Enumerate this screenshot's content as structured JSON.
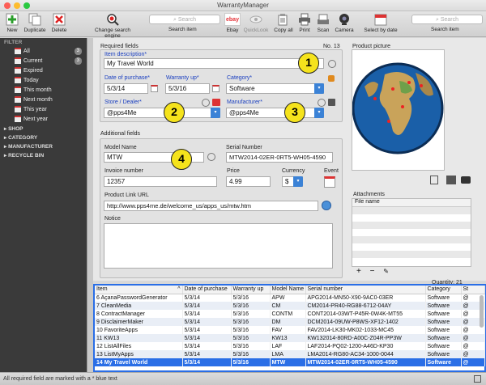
{
  "window": {
    "title": "WarrantyManager"
  },
  "toolbar": {
    "new": "New",
    "duplicate": "Duplicate",
    "delete": "Delete",
    "change_search_engine": "Change search engine",
    "search_item": "Search item",
    "search_placeholder": "Search",
    "ebay": "Ebay",
    "quicklook": "QuickLook",
    "copy_all": "Copy all",
    "print": "Print",
    "scan": "Scan",
    "camera": "Camera",
    "select_by_date": "Select by date",
    "search_item2": "Search item",
    "search_placeholder2": "Search",
    "ebay_logo": "ebay"
  },
  "sidebar": {
    "filter_heading": "FILTER",
    "items": [
      {
        "label": "All",
        "badge": "3"
      },
      {
        "label": "Current",
        "badge": "3"
      },
      {
        "label": "Expired",
        "badge": ""
      },
      {
        "label": "Today",
        "badge": ""
      },
      {
        "label": "This month",
        "badge": ""
      },
      {
        "label": "Next month",
        "badge": ""
      },
      {
        "label": "This year",
        "badge": ""
      },
      {
        "label": "Next year",
        "badge": ""
      }
    ],
    "sections": [
      "SHOP",
      "CATEGORY",
      "MANUFACTURER",
      "RECYCLE BIN"
    ]
  },
  "form": {
    "required_heading": "Required fields",
    "record_no": "No. 13",
    "item_description_label": "Item description*",
    "item_description": "My Travel World",
    "date_of_purchase_label": "Date of purchase*",
    "date_of_purchase": "5/3/14",
    "warranty_up_label": "Warranty up*",
    "warranty_up": "5/3/16",
    "category_label": "Category*",
    "category": "Software",
    "store_label": "Store / Dealer*",
    "store": "@pps4Me",
    "manufacturer_label": "Manufacturer*",
    "manufacturer": "@pps4Me",
    "additional_heading": "Additional fields",
    "model_name_label": "Model Name",
    "model_name": "MTW",
    "serial_number_label": "Serial Number",
    "serial_number": "MTW2014-02ER-0RT5-WH05-4590",
    "invoice_number_label": "Invoice number",
    "invoice_number": "12357",
    "price_label": "Price",
    "price": "4.99",
    "currency_label": "Currency",
    "currency": "$",
    "event_label": "Event",
    "product_link_label": "Product Link URL",
    "product_link": "http://www.pps4me.de/welcome_us/apps_us/mtw.htm",
    "notice_label": "Notice"
  },
  "callouts": [
    "1",
    "2",
    "3",
    "4"
  ],
  "right_panel": {
    "product_picture_label": "Product picture",
    "attachments_label": "Attachments",
    "attachments_column": "File name",
    "add": "+",
    "remove": "−"
  },
  "table": {
    "quantity": "Quantity: 21",
    "columns": [
      "Item",
      "Date of purchase",
      "Warranty up",
      "Model Name",
      "Serial number",
      "Category",
      "St"
    ],
    "sort_indicator": "^",
    "rows": [
      [
        "6  AçanaPasswordGenerator",
        "5/3/14",
        "5/3/16",
        "APW",
        "APG2014-MN50-X90-9AC0-03ER",
        "Software",
        "@"
      ],
      [
        "7  CleanMedia",
        "5/3/14",
        "5/3/16",
        "CM",
        "CM2014-PR40-RG88-6712-04AY",
        "Software",
        "@"
      ],
      [
        "8  ContractManager",
        "5/3/14",
        "5/3/16",
        "CONTM",
        "CONT2014-03WT-P45R-0W4K-MT55",
        "Software",
        "@"
      ],
      [
        "9  DisclaimerMaker",
        "5/3/14",
        "5/3/16",
        "DM",
        "DCM2014-09UW-P8WS-XF12-1402",
        "Software",
        "@"
      ],
      [
        "10 FavoriteApps",
        "5/3/14",
        "5/3/16",
        "FAV",
        "FAV2014-LK30-MK02-1033-MC45",
        "Software",
        "@"
      ],
      [
        "11 KW13",
        "5/3/14",
        "5/3/16",
        "KW13",
        "KW132014-80RD-A00C-Z04R-PP3W",
        "Software",
        "@"
      ],
      [
        "12 ListAllFiles",
        "5/3/14",
        "5/3/16",
        "LAF",
        "LAF2014-PQ02-1200-A46D-KP30",
        "Software",
        "@"
      ],
      [
        "13 ListMyApps",
        "5/3/14",
        "5/3/16",
        "LMA",
        "LMA2014-RG80-AC34-1000-0044",
        "Software",
        "@"
      ],
      [
        "14 My Travel World",
        "5/3/14",
        "5/3/16",
        "MTW",
        "MTW2014-02ER-0RT5-WH05-4590",
        "Software",
        "@"
      ]
    ],
    "selected_index": 8
  },
  "status": {
    "text": "All required field are marked with a * blue text"
  },
  "colors": {
    "accent": "#2a6ee6",
    "callout": "#f5e31c",
    "sidebar": "#3a3a3a",
    "required_label": "#1a3fc0"
  }
}
